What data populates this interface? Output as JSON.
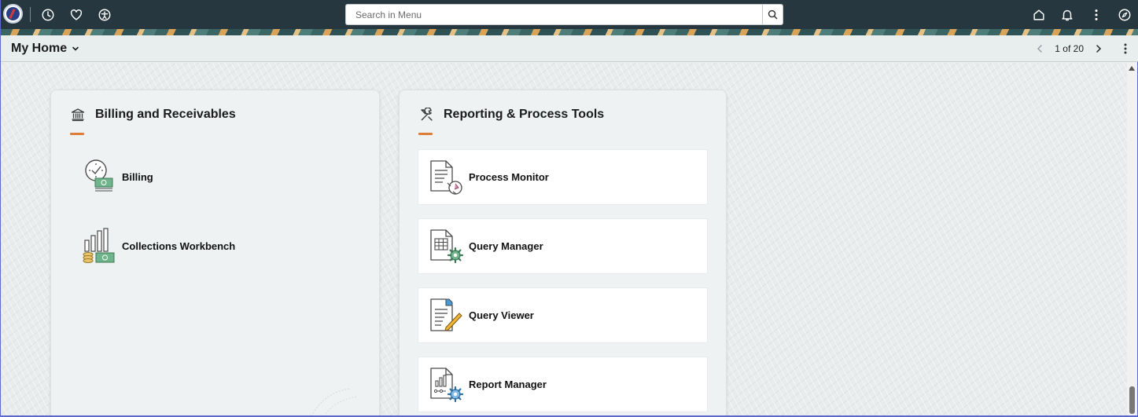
{
  "topbar": {
    "logo_icon": "university-logo",
    "icons": [
      "recent-history-icon",
      "favorites-icon",
      "accessibility-icon"
    ],
    "search_placeholder": "Search in Menu",
    "right_icons": [
      "home-icon",
      "notifications-icon",
      "more-actions-icon",
      "navigator-compass-icon"
    ]
  },
  "page": {
    "title": "My Home",
    "pager": "1 of 20"
  },
  "tiles": {
    "billing": {
      "title": "Billing and Receivables",
      "icon": "bank-icon",
      "items": [
        {
          "label": "Billing",
          "icon": "billing-clock-money-icon"
        },
        {
          "label": "Collections Workbench",
          "icon": "collections-chart-money-icon"
        }
      ]
    },
    "reporting": {
      "title": "Reporting & Process Tools",
      "icon": "tools-icon",
      "items": [
        {
          "label": "Process Monitor",
          "icon": "process-monitor-icon"
        },
        {
          "label": "Query Manager",
          "icon": "query-manager-icon"
        },
        {
          "label": "Query Viewer",
          "icon": "query-viewer-icon"
        },
        {
          "label": "Report Manager",
          "icon": "report-manager-icon"
        }
      ]
    }
  },
  "colors": {
    "topbar": "#27373f",
    "accent_underline": "#e07c3a",
    "icon_green": "#5fa07a"
  }
}
